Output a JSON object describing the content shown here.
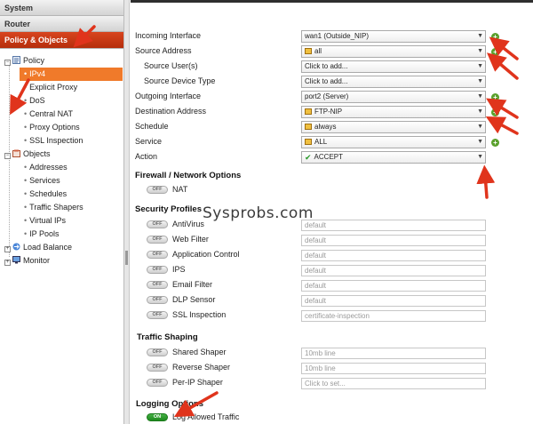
{
  "nav": {
    "system": "System",
    "router": "Router",
    "policy_objects": "Policy & Objects",
    "tree": {
      "policy": "Policy",
      "policy_items": [
        "IPv4",
        "Explicit Proxy",
        "DoS",
        "Central NAT",
        "Proxy Options",
        "SSL Inspection"
      ],
      "objects": "Objects",
      "objects_items": [
        "Addresses",
        "Services",
        "Schedules",
        "Traffic Shapers",
        "Virtual IPs",
        "IP Pools"
      ],
      "load_balance": "Load Balance",
      "monitor": "Monitor"
    }
  },
  "form": {
    "incoming_interface": {
      "label": "Incoming Interface",
      "value": "wan1 (Outside_NIP)"
    },
    "source_address": {
      "label": "Source Address",
      "value": "all"
    },
    "source_users": {
      "label": "Source User(s)",
      "value": "Click to add..."
    },
    "source_device_type": {
      "label": "Source Device Type",
      "value": "Click to add..."
    },
    "outgoing_interface": {
      "label": "Outgoing Interface",
      "value": "port2 (Server)"
    },
    "destination_address": {
      "label": "Destination Address",
      "value": "FTP-NIP"
    },
    "schedule": {
      "label": "Schedule",
      "value": "always"
    },
    "service": {
      "label": "Service",
      "value": "ALL"
    },
    "action": {
      "label": "Action",
      "value": "ACCEPT"
    }
  },
  "toggle_text": {
    "off": "OFF",
    "on": "ON"
  },
  "firewall": {
    "heading": "Firewall / Network Options",
    "nat": "NAT"
  },
  "security": {
    "heading": "Security Profiles",
    "items": [
      {
        "label": "AntiVirus",
        "value": "default"
      },
      {
        "label": "Web Filter",
        "value": "default"
      },
      {
        "label": "Application Control",
        "value": "default"
      },
      {
        "label": "IPS",
        "value": "default"
      },
      {
        "label": "Email Filter",
        "value": "default"
      },
      {
        "label": "DLP Sensor",
        "value": "default"
      },
      {
        "label": "SSL Inspection",
        "value": "certificate-inspection"
      }
    ]
  },
  "shaping": {
    "heading": "Traffic Shaping",
    "items": [
      {
        "label": "Shared Shaper",
        "value": "10mb line"
      },
      {
        "label": "Reverse Shaper",
        "value": "10mb line"
      },
      {
        "label": "Per-IP Shaper",
        "value": "Click to set..."
      }
    ]
  },
  "logging": {
    "heading": "Logging Options",
    "log_allowed": "Log Allowed Traffic"
  },
  "watermark": "Sysprobs.com",
  "colors": {
    "accent_nav": "#c3390f",
    "selected_item": "#f07a2a",
    "annotation_arrow": "#e0341c",
    "plus_green": "#5aa02c",
    "toggle_on": "#2a9a2a"
  }
}
